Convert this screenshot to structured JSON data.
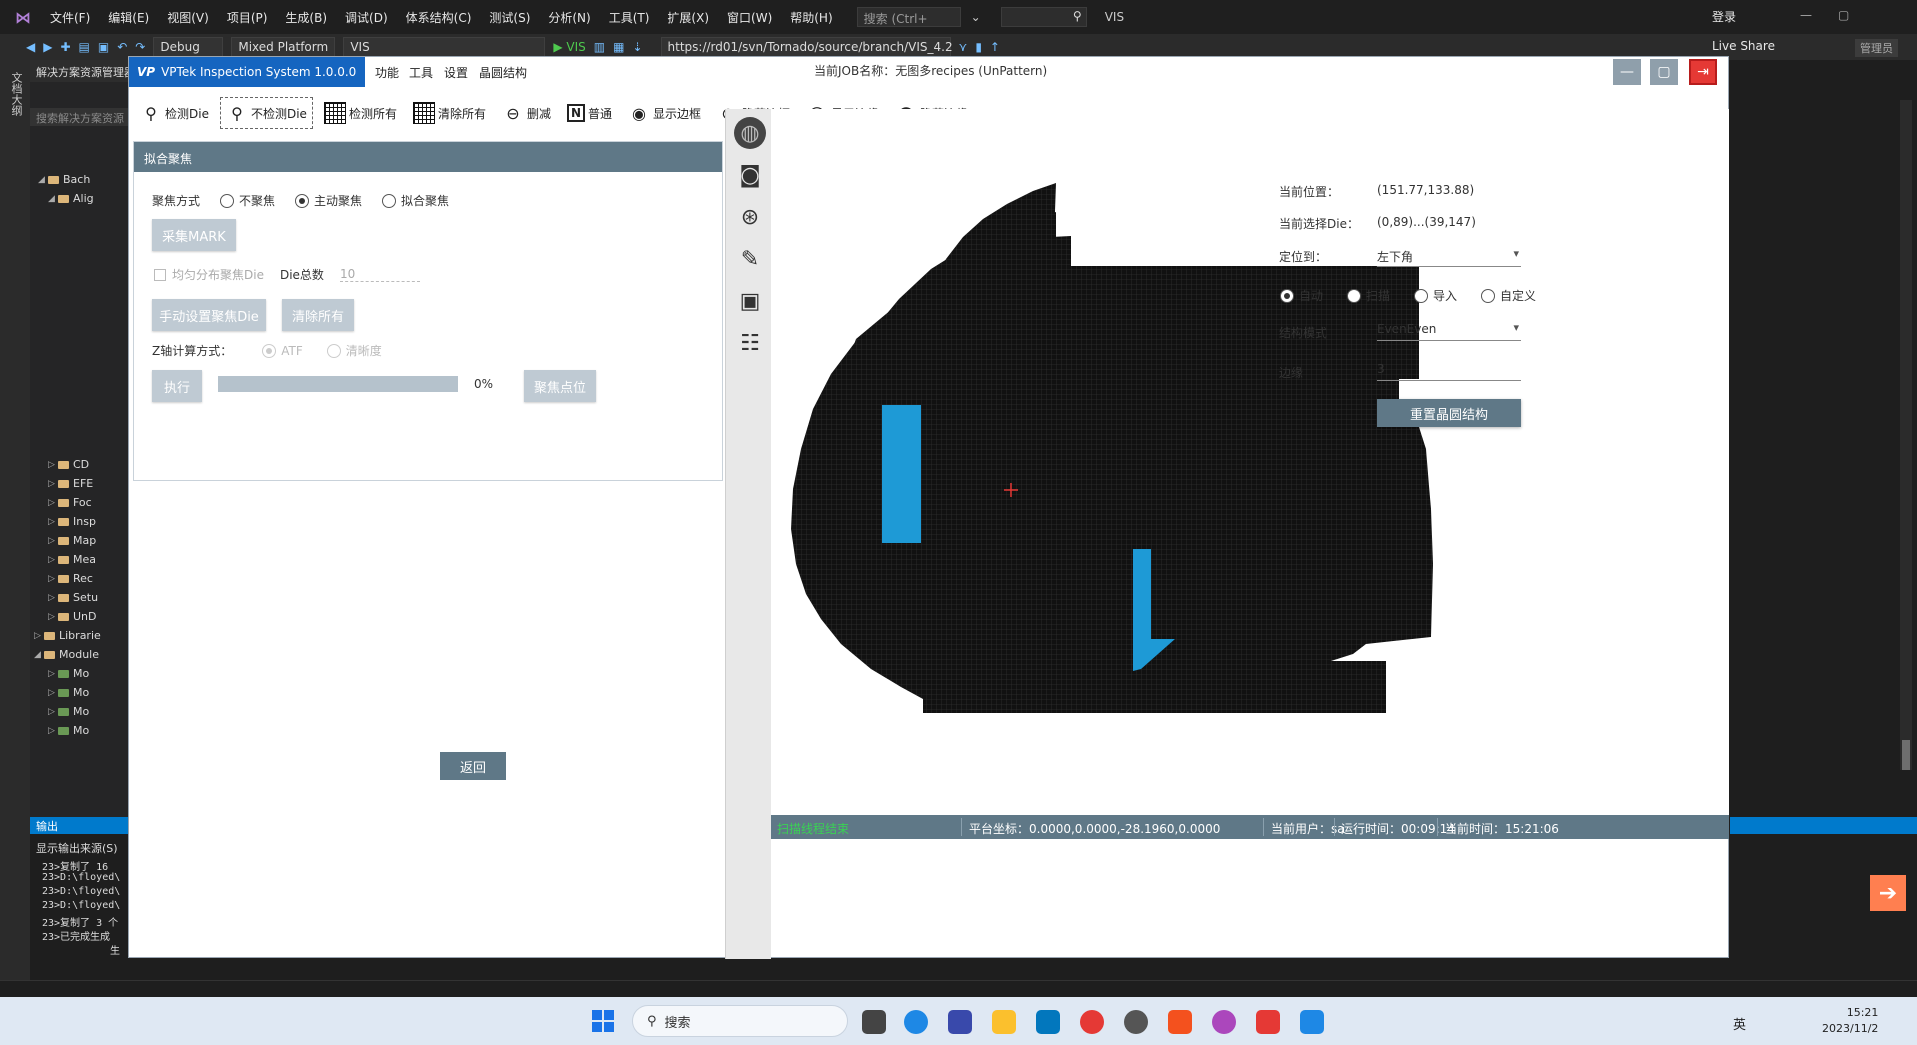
{
  "vs": {
    "menus": [
      "文件(F)",
      "编辑(E)",
      "视图(V)",
      "项目(P)",
      "生成(B)",
      "调试(D)",
      "体系结构(C)",
      "测试(S)",
      "分析(N)",
      "工具(T)",
      "扩展(X)",
      "窗口(W)",
      "帮助(H)"
    ],
    "search_placeholder": "搜索 (Ctrl+",
    "vis_tag": "VIS",
    "login": "登录",
    "config": "Debug",
    "platform": "Mixed Platform",
    "project": "VIS",
    "run_label": "▶ VIS",
    "svn_path": "https://rd01/svn/Tornado/source/branch/VIS_4.2",
    "live_share": "Live Share",
    "admin": "管理员",
    "sidebar_title": "解决方案资源管理器",
    "sidebar_search": "搜索解决方案资源",
    "left_rail_label": "文档大纲",
    "tree": [
      "Bach",
      "Alig",
      "CD",
      "EFE",
      "Foc",
      "Insp",
      "Map",
      "Mea",
      "Rec",
      "Setu",
      "UnD",
      "Librarie",
      "Module",
      "Mo",
      "Mo",
      "Mo",
      "Mo",
      "Mo"
    ],
    "output_title": "输出",
    "output_source": "显示输出来源(S)",
    "output_lines": [
      "23>复制了 16",
      "23>D:\\floyed\\",
      "23>D:\\floyed\\",
      "23>D:\\floyed\\",
      "23>复制了 3 个",
      "23>已完成生成",
      "生"
    ]
  },
  "app": {
    "title": "VPTek Inspection System 1.0.0.0",
    "logo": "VP",
    "menus": [
      "功能",
      "工具",
      "设置",
      "晶圆结构"
    ],
    "job_name": "当前JOB名称：无图多recipes (UnPattern)"
  },
  "toolbar": [
    {
      "label": "检测Die",
      "icon": "magnifier-icon"
    },
    {
      "label": "不检测Die",
      "icon": "magnifier-icon"
    },
    {
      "label": "检测所有",
      "icon": "grid-icon"
    },
    {
      "label": "清除所有",
      "icon": "grid-icon"
    },
    {
      "label": "删减",
      "icon": "minus-circle-icon"
    },
    {
      "label": "普通",
      "icon": "n-box-icon"
    },
    {
      "label": "显示边框",
      "icon": "eye-icon"
    },
    {
      "label": "隐藏边框",
      "icon": "eye-slash-icon"
    },
    {
      "label": "显示边缘",
      "icon": "circle-icon"
    },
    {
      "label": "隐藏边缘",
      "icon": "filled-circle-icon"
    }
  ],
  "focus_panel": {
    "title": "拟合聚焦",
    "mode_label": "聚焦方式",
    "modes": [
      "不聚焦",
      "主动聚焦",
      "拟合聚焦"
    ],
    "selected_mode": "主动聚焦",
    "collect_mark": "采集MARK",
    "uniform_label": "均匀分布聚焦Die",
    "die_total_label": "Die总数",
    "die_total_value": "10",
    "manual_set": "手动设置聚焦Die",
    "clear_all": "清除所有",
    "z_calc_label": "Z轴计算方式：",
    "z_options": [
      "ATF",
      "清晰度"
    ],
    "execute": "执行",
    "progress": "0%",
    "focus_point": "聚焦点位",
    "back": "返回"
  },
  "info": {
    "position_label": "当前位置：",
    "position_value": "(151.77,133.88)",
    "selected_die_label": "当前选择Die：",
    "selected_die_value": "(0,89)...(39,147)",
    "locate_label": "定位到：",
    "locate_value": "左下角",
    "locate_modes": [
      "自动",
      "扫描",
      "导入",
      "自定义"
    ],
    "selected_locate_mode": "自动",
    "structure_label": "结构模式",
    "structure_value": "EvenEven",
    "edge_label": "边缘",
    "edge_value": "3",
    "reset_button": "重置晶圆结构"
  },
  "status": {
    "message": "扫描线程结束",
    "platform_coords": "平台坐标：0.0000,0.0000,-28.1960,0.0000",
    "user": "当前用户：sa",
    "runtime": "运行时间：00:09:14",
    "current_time": "当前时间：15:21:06"
  },
  "taskbar": {
    "search": "搜索",
    "ime": "英",
    "time": "15:21",
    "date": "2023/11/2"
  },
  "colors": {
    "accent": "#1565c0",
    "panel_header": "#5f7887",
    "die_grid": "#111111",
    "die_selected": "#1e9ad6",
    "status_ok": "#39d353"
  }
}
